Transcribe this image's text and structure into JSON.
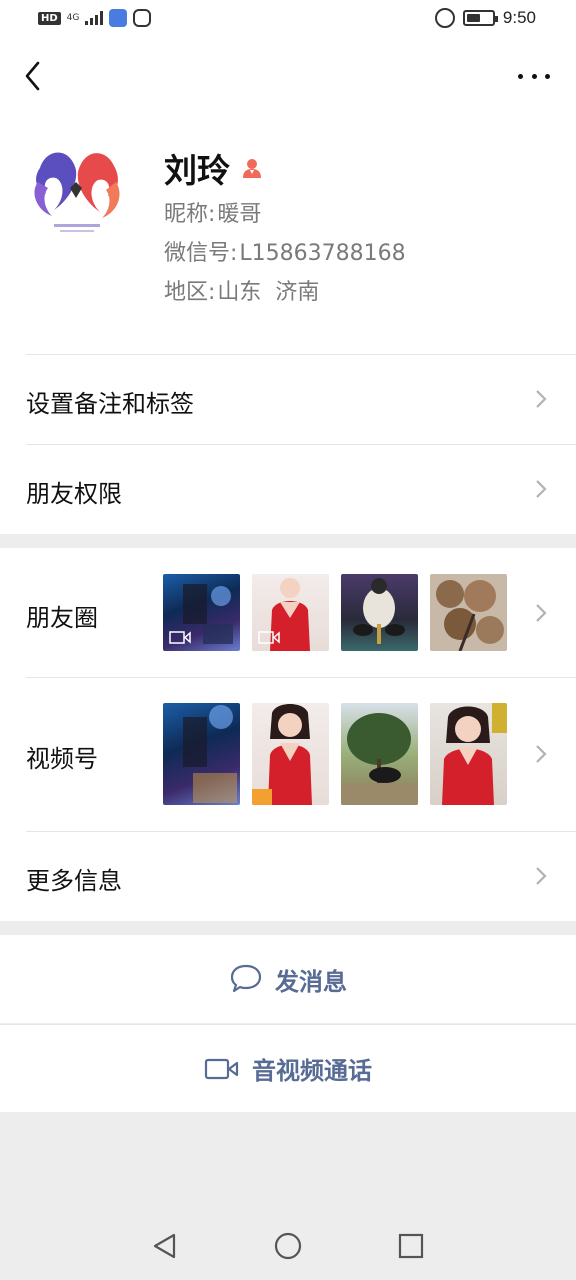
{
  "status_bar": {
    "network_label": "HD",
    "network_type": "4G",
    "time": "9:50",
    "battery_level": 0.55
  },
  "nav": {
    "back_icon": "chevron-left-icon",
    "more_icon": "more-dots-icon"
  },
  "profile": {
    "name": "刘玲",
    "gender_icon": "female-user-icon",
    "nickname_label": "昵称:",
    "nickname": "暖哥",
    "wechat_id_label": "微信号:",
    "wechat_id": "L15863788168",
    "region_label": "地区:",
    "region": "山东  济南"
  },
  "menu": {
    "set_remark_tags": "设置备注和标签",
    "friend_permissions": "朋友权限",
    "moments": "朋友圈",
    "channels": "视频号",
    "more_info": "更多信息"
  },
  "actions": {
    "send_message": "发消息",
    "video_call": "音视频通话"
  },
  "colors": {
    "link_blue": "#576b95",
    "background": "#ededed",
    "divider": "#e5e5e5",
    "secondary_text": "#7a7a7a"
  }
}
